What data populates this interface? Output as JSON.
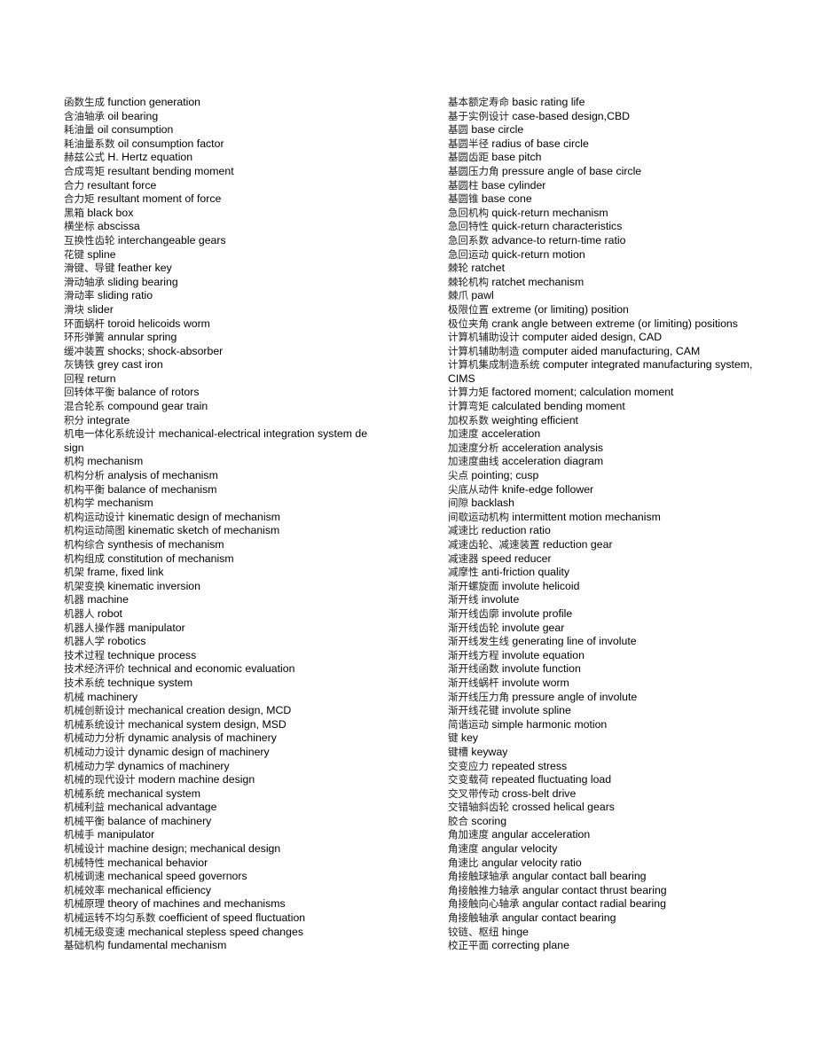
{
  "left_column": [
    {
      "zh": "函数生成",
      "en": "function generation"
    },
    {
      "zh": "含油轴承",
      "en": "oil bearing"
    },
    {
      "zh": "耗油量",
      "en": "oil consumption"
    },
    {
      "zh": "耗油量系数",
      "en": "oil consumption factor"
    },
    {
      "zh": "赫兹公式",
      "en": "H. Hertz equation"
    },
    {
      "zh": "合成弯矩",
      "en": "resultant bending moment"
    },
    {
      "zh": "合力",
      "en": "resultant force"
    },
    {
      "zh": "合力矩",
      "en": "resultant moment of force"
    },
    {
      "zh": "黑箱",
      "en": "black box"
    },
    {
      "zh": "横坐标",
      "en": "abscissa"
    },
    {
      "zh": "互换性齿轮",
      "en": "interchangeable gears"
    },
    {
      "zh": "花键",
      "en": "spline"
    },
    {
      "zh": "滑键、导键",
      "en": "feather key"
    },
    {
      "zh": "滑动轴承",
      "en": "sliding bearing"
    },
    {
      "zh": "滑动率",
      "en": "sliding ratio"
    },
    {
      "zh": "滑块",
      "en": "slider"
    },
    {
      "zh": "环面蜗杆",
      "en": "toroid helicoids worm"
    },
    {
      "zh": "环形弹簧",
      "en": "annular spring"
    },
    {
      "zh": "缓冲装置",
      "en": "shocks; shock-absorber"
    },
    {
      "zh": "灰铸铁",
      "en": "grey cast iron"
    },
    {
      "zh": "回程",
      "en": "return"
    },
    {
      "zh": "回转体平衡",
      "en": "balance of rotors"
    },
    {
      "zh": "混合轮系",
      "en": " compound gear train"
    },
    {
      "zh": "积分",
      "en": "integrate"
    },
    {
      "zh": "机电一体化系统设计",
      "en": "mechanical-electrical integration system design"
    },
    {
      "zh": "机构",
      "en": "mechanism"
    },
    {
      "zh": "机构分析",
      "en": "analysis of mechanism"
    },
    {
      "zh": "机构平衡",
      "en": "balance of mechanism"
    },
    {
      "zh": "机构学",
      "en": "mechanism"
    },
    {
      "zh": "机构运动设计",
      "en": "kinematic design of mechanism"
    },
    {
      "zh": "机构运动简图",
      "en": "kinematic sketch of mechanism"
    },
    {
      "zh": "机构综合",
      "en": "synthesis of mechanism"
    },
    {
      "zh": "机构组成",
      "en": "constitution of mechanism"
    },
    {
      "zh": "机架",
      "en": "frame, fixed link"
    },
    {
      "zh": "机架变换",
      "en": "kinematic inversion"
    },
    {
      "zh": "机器",
      "en": "machine"
    },
    {
      "zh": "机器人",
      "en": "robot"
    },
    {
      "zh": "机器人操作器",
      "en": "manipulator"
    },
    {
      "zh": "机器人学",
      "en": "robotics"
    },
    {
      "zh": "技术过程",
      "en": "technique process"
    },
    {
      "zh": "技术经济评价",
      "en": "technical and economic evaluation"
    },
    {
      "zh": "技术系统",
      "en": "technique system"
    },
    {
      "zh": "机械",
      "en": "machinery"
    },
    {
      "zh": "机械创新设计",
      "en": "mechanical creation design, MCD"
    },
    {
      "zh": "机械系统设计",
      "en": "mechanical system design, MSD"
    },
    {
      "zh": "机械动力分析",
      "en": "dynamic analysis of machinery"
    },
    {
      "zh": "机械动力设计",
      "en": "dynamic design of machinery"
    },
    {
      "zh": "机械动力学",
      "en": "dynamics of machinery"
    },
    {
      "zh": "机械的现代设计",
      "en": "modern machine design"
    },
    {
      "zh": "机械系统",
      "en": "mechanical system"
    },
    {
      "zh": "机械利益",
      "en": "mechanical advantage"
    },
    {
      "zh": "机械平衡",
      "en": "balance of machinery"
    },
    {
      "zh": "机械手",
      "en": "manipulator"
    },
    {
      "zh": "机械设计",
      "en": "machine design; mechanical design"
    },
    {
      "zh": "机械特性",
      "en": "mechanical behavior"
    },
    {
      "zh": "机械调速",
      "en": "mechanical speed governors"
    },
    {
      "zh": "机械效率",
      "en": "mechanical efficiency"
    },
    {
      "zh": "机械原理",
      "en": "theory of machines and mechanisms"
    },
    {
      "zh": "机械运转不均匀系数",
      "en": "coefficient of speed fluctuation"
    },
    {
      "zh": "机械无级变速",
      "en": "mechanical stepless speed changes"
    },
    {
      "zh": "基础机构",
      "en": "fundamental mechanism"
    }
  ],
  "right_column": [
    {
      "zh": "基本额定寿命",
      "en": "basic rating life"
    },
    {
      "zh": "基于实例设计",
      "en": "case-based design,CBD"
    },
    {
      "zh": "基圆",
      "en": "base circle"
    },
    {
      "zh": "基圆半径",
      "en": "radius of base circle"
    },
    {
      "zh": "基圆齿距",
      "en": "base pitch"
    },
    {
      "zh": "基圆压力角",
      "en": "pressure angle of base circle"
    },
    {
      "zh": "基圆柱",
      "en": "base cylinder"
    },
    {
      "zh": "基圆锥",
      "en": "base cone"
    },
    {
      "zh": "急回机构",
      "en": "quick-return mechanism"
    },
    {
      "zh": "急回特性",
      "en": "quick-return characteristics"
    },
    {
      "zh": "急回系数",
      "en": "advance-to return-time ratio"
    },
    {
      "zh": "急回运动",
      "en": "quick-return motion"
    },
    {
      "zh": "棘轮",
      "en": "ratchet"
    },
    {
      "zh": "棘轮机构",
      "en": "ratchet mechanism"
    },
    {
      "zh": "棘爪",
      "en": "pawl"
    },
    {
      "zh": "极限位置",
      "en": "extreme (or limiting) position"
    },
    {
      "zh": "极位夹角",
      "en": "crank angle between extreme (or limiting) positions"
    },
    {
      "zh": "计算机辅助设计",
      "en": "computer aided design, CAD"
    },
    {
      "zh": "计算机辅助制造",
      "en": "computer aided manufacturing, CAM"
    },
    {
      "zh": "计算机集成制造系统",
      "en": "computer integrated manufacturing system, CIMS"
    },
    {
      "zh": "计算力矩",
      "en": "factored moment; calculation moment"
    },
    {
      "zh": "计算弯矩",
      "en": "calculated bending moment"
    },
    {
      "zh": "加权系数",
      "en": "weighting efficient"
    },
    {
      "zh": "加速度",
      "en": "acceleration"
    },
    {
      "zh": "加速度分析",
      "en": "acceleration analysis"
    },
    {
      "zh": "加速度曲线",
      "en": "acceleration diagram"
    },
    {
      "zh": "尖点",
      "en": "pointing; cusp"
    },
    {
      "zh": "尖底从动件",
      "en": "knife-edge follower"
    },
    {
      "zh": "间隙",
      "en": "backlash"
    },
    {
      "zh": "间歇运动机构",
      "en": "intermittent motion mechanism"
    },
    {
      "zh": "减速比",
      "en": "reduction ratio"
    },
    {
      "zh": "减速齿轮、减速装置",
      "en": "reduction gear"
    },
    {
      "zh": "减速器",
      "en": "speed reducer"
    },
    {
      "zh": "减摩性",
      "en": "anti-friction quality"
    },
    {
      "zh": "渐开螺旋面",
      "en": "involute helicoid"
    },
    {
      "zh": "渐开线",
      "en": "involute"
    },
    {
      "zh": "渐开线齿廓",
      "en": "involute profile"
    },
    {
      "zh": "渐开线齿轮",
      "en": "involute gear"
    },
    {
      "zh": "渐开线发生线",
      "en": "generating line of involute"
    },
    {
      "zh": "渐开线方程",
      "en": "involute equation"
    },
    {
      "zh": "渐开线函数",
      "en": "involute function"
    },
    {
      "zh": "渐开线蜗杆",
      "en": "involute worm"
    },
    {
      "zh": "渐开线压力角",
      "en": "pressure angle of involute"
    },
    {
      "zh": "渐开线花键",
      "en": "involute spline"
    },
    {
      "zh": "简谐运动",
      "en": "simple harmonic motion"
    },
    {
      "zh": "键",
      "en": "key"
    },
    {
      "zh": "键槽",
      "en": "keyway"
    },
    {
      "zh": "交变应力",
      "en": "repeated stress"
    },
    {
      "zh": "交变载荷",
      "en": "repeated fluctuating load"
    },
    {
      "zh": "交叉带传动",
      "en": "cross-belt drive"
    },
    {
      "zh": "交错轴斜齿轮",
      "en": "crossed helical gears"
    },
    {
      "zh": "胶合",
      "en": "scoring"
    },
    {
      "zh": "角加速度",
      "en": "angular acceleration"
    },
    {
      "zh": "角速度",
      "en": "angular velocity"
    },
    {
      "zh": "角速比",
      "en": "angular velocity ratio"
    },
    {
      "zh": "角接触球轴承",
      "en": "angular contact ball bearing"
    },
    {
      "zh": "角接触推力轴承",
      "en": "angular contact thrust bearing"
    },
    {
      "zh": "角接触向心轴承",
      "en": "angular contact radial bearing"
    },
    {
      "zh": "角接触轴承",
      "en": "angular contact bearing"
    },
    {
      "zh": "铰链、枢纽",
      "en": "hinge"
    },
    {
      "zh": "校正平面",
      "en": "correcting plane"
    }
  ]
}
